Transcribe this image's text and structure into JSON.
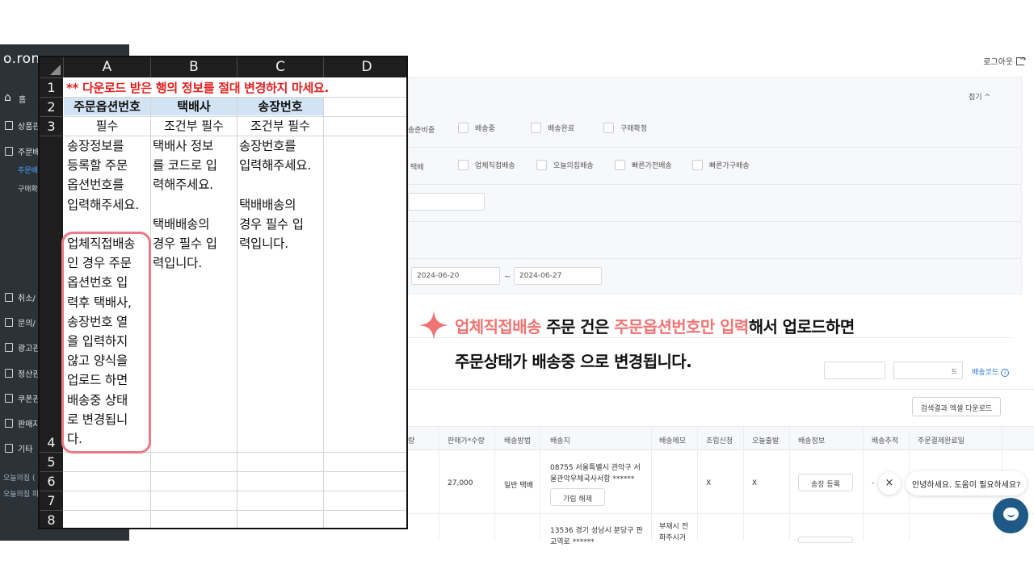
{
  "app": {
    "logo": "o.ron",
    "logout_label": "로그아웃"
  },
  "sidebar": {
    "items": [
      {
        "label": "홈"
      },
      {
        "label": "상품관"
      },
      {
        "label": "주문배"
      },
      {
        "label": "취소/"
      },
      {
        "label": "문의/"
      },
      {
        "label": "광고관"
      },
      {
        "label": "정산관"
      },
      {
        "label": "쿠폰관"
      },
      {
        "label": "판매자"
      },
      {
        "label": "기타"
      }
    ],
    "subitems": [
      {
        "label": "주문배",
        "active": true
      },
      {
        "label": "구매확",
        "active": false
      }
    ],
    "footer": [
      "오늘의집 (",
      "오늘의집 파"
    ]
  },
  "filter_panel": {
    "collapse_label": "접기 ^",
    "status_options": [
      "송준비중",
      "배송중",
      "배송완료",
      "구매확정"
    ],
    "method_options": [
      "택배",
      "업체직접배송",
      "오늘의집배송",
      "빠른가전배송",
      "빠른가구배송"
    ],
    "date_from": "2024-06-20",
    "date_to": "2024-06-27",
    "date_sep": "~"
  },
  "toolbar": {
    "select_value": "드",
    "ship_code_link": "배송코드",
    "excel_download": "검색결과 엑셀 다운로드"
  },
  "grid": {
    "headers": [
      "량",
      "판매가*수량",
      "배송방법",
      "배송지",
      "배송메모",
      "조립신청",
      "오늘출발",
      "배송정보",
      "배송추적",
      "주문결제완료일"
    ],
    "rows": [
      {
        "price": "27,000",
        "method": "일반 택배",
        "address_line1": "08755 서울특별시 관악구 서",
        "address_line2": "울관악우체국사서함 ******",
        "hold_btn": "가림 해제",
        "assembly": "X",
        "today": "X",
        "ship_btn": "송장 등록",
        "tracking": "-"
      },
      {
        "address_line1": "13536 경기 성남시 분당구 판",
        "address_line2": "교역로 ******",
        "memo_line1": "부재시 전",
        "memo_line2": "화주시거"
      }
    ]
  },
  "chat": {
    "greeting": "안녕하세요. 도움이 필요하세요?",
    "close": "×"
  },
  "callout": {
    "line1_red1": "업체직접배송",
    "line1_mid": " 주문 건은 ",
    "line1_red2": "주문옵션번호만 입력",
    "line1_end": "해서 업로드하면",
    "line2": "주문상태가 배송중 으로 변경됩니다."
  },
  "excel": {
    "columns": [
      "A",
      "B",
      "C",
      "D"
    ],
    "rows": [
      "1",
      "2",
      "3",
      "4",
      "5",
      "6",
      "7",
      "8"
    ],
    "notice": "** 다운로드 받은 행의 정보를 절대 변경하지 마세요.",
    "headers": [
      "주문옵션번호",
      "택배사",
      "송장번호"
    ],
    "requirements": [
      "필수",
      "조건부 필수",
      "조건부 필수"
    ],
    "desc_a": "송장정보를\n등록할 주문\n옵션번호를\n입력해주세요.\n\n업체직접배송\n인 경우 주문\n옵션번호 입\n력후 택배사,\n송장번호 열\n을 입력하지\n않고 양식을\n업로드 하면\n배송중 상태\n로 변경됩니\n다.",
    "desc_b": "택배사 정보\n를 코드로 입\n력해주세요.\n\n택배배송의\n경우 필수 입\n력입니다.",
    "desc_c": "송장번호를\n입력해주세요.\n\n택배배송의\n경우 필수 입\n력입니다."
  },
  "colors": {
    "accent_red": "#f07474",
    "notice_red": "#e02020",
    "header_blue": "#d2e4f4",
    "highlight_pink": "#ec7a86",
    "sidebar_bg": "#2b3238",
    "chat_blue": "#1f5a86",
    "link_blue": "#2b78d1"
  }
}
